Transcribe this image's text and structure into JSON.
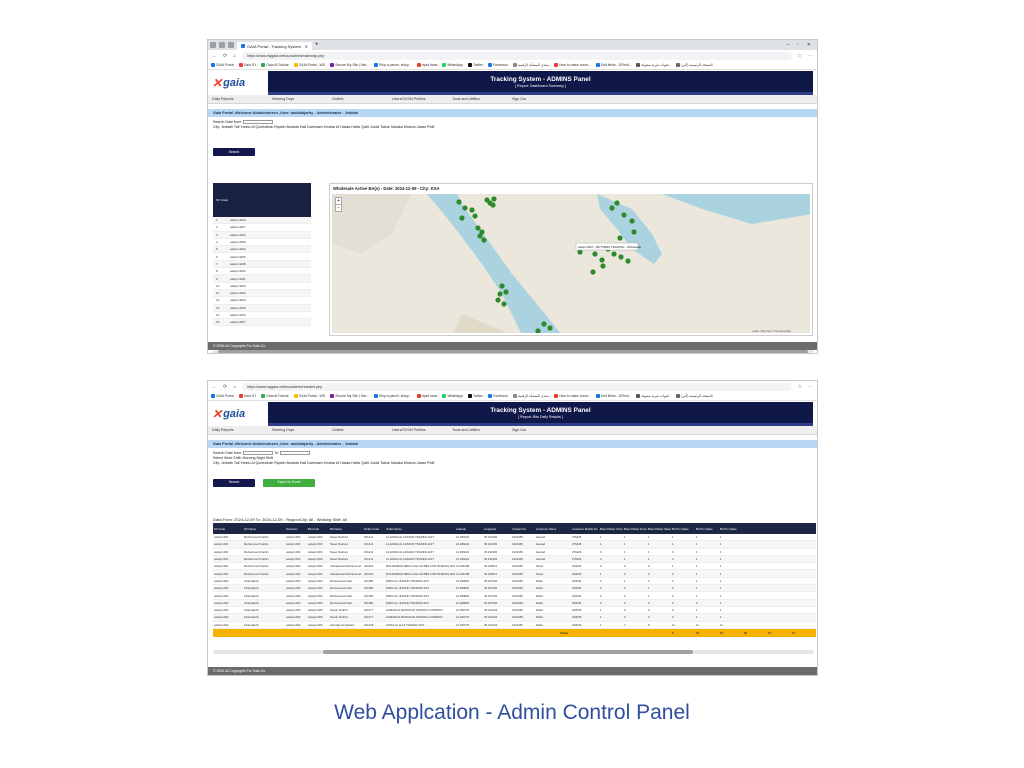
{
  "browser": {
    "tab_title": "GAIA Portal - Tracking System",
    "url_top": "https://www.mygaia.net/sso/admin/mainmap.php",
    "url_bottom": "https://www.mygaia.net/sso/admin/resultmi.php",
    "bookmarks": [
      "GAIA Portal",
      "Gaia SY",
      "Gaia Al Fakhar",
      "GAIA Portal - WD",
      "Secure My Site | Net...",
      "Ship a parcel, shipp...",
      "riyad bank",
      "WhatsApp",
      "Twitter",
      "Facebook",
      "منتدى المنشأة الرقمية",
      "How to make count...",
      "Edit fields - DFIeld...",
      "قنوات غيرية منقولة...",
      "الصفحة الرئيسية (أثير)"
    ]
  },
  "app": {
    "logo_text": "gaia",
    "title": "Tracking System - ADMINS Panel",
    "subtitle_top": "[ Report: Dashboard Summary ]",
    "subtitle_bottom": "[ Report: Bits Daily Results ]",
    "menu": [
      "Daily Reports",
      "Working Days",
      "Outlets",
      "Users/SVSM Profiles",
      "Tools and Utilities",
      "Sign Out"
    ],
    "welcome": "Gaia Portal ,Welcome Abdulmohsen ,User: abdulaljarhy - Administrator - Jeddah"
  },
  "top_screen": {
    "search_label": "Search Date from:",
    "city_line": "City: Jeddah Taif Yanbu Al Qunfudhah Riyadh Buraida Hail Dammam Khobar Al Hassa Hafar Qatif Jubail Tabuk Sakaka Khamis Jazan Rhill",
    "search_button": "Search",
    "table_header": "SV Code",
    "table_rows": [
      {
        "n": "1",
        "code": "salsprm003"
      },
      {
        "n": "2",
        "code": "salsprm007"
      },
      {
        "n": "3",
        "code": "salsprm002"
      },
      {
        "n": "4",
        "code": "salsprm006"
      },
      {
        "n": "5",
        "code": "salsprm002"
      },
      {
        "n": "6",
        "code": "salsprm009"
      },
      {
        "n": "7",
        "code": "salsprm008"
      },
      {
        "n": "8",
        "code": "salsprm002"
      },
      {
        "n": "9",
        "code": "salsprm001"
      },
      {
        "n": "10",
        "code": "salsprm003"
      },
      {
        "n": "11",
        "code": "salsprm004"
      },
      {
        "n": "12",
        "code": "salsprm003"
      },
      {
        "n": "13",
        "code": "salsprm006"
      },
      {
        "n": "14",
        "code": "salsprm003"
      },
      {
        "n": "15",
        "code": "salsprm007"
      }
    ],
    "map_title": "Wholesale Active BA(s) - Date: 2024-12-09 - City: KSA",
    "map_popup": "salsprm007 - BUTTERS TRADING - Wholesale",
    "zoom_in": "+",
    "zoom_out": "−",
    "map_attribution": "Leaflet | Map data © OpenStreetMap",
    "footer": "© 2006 All Copyrights For Gaia Co."
  },
  "bottom_screen": {
    "search_label": "Search Date from:",
    "to_label": "To:",
    "shift_line": "Select Work Shift: Morning Night Shift",
    "city_line": "City: Jeddah Taif Yanbu Al Qunfudhah Riyadh Buraida Hail Dammam Khobar Al Hassa Hafar Qatif Jubail Tabuk Sakaka Khamis Jazan Rhill",
    "search_button": "Search",
    "export_button": "Export to Excel",
    "result_title": "Data From: 2024-12-09 To: 2024-12-09 - Region/City: All - Working Shift: All",
    "columns": [
      "SV Code",
      "SV Name",
      "Promoter",
      "BA Code",
      "BA Name",
      "Outlet Code",
      "Outlet Name",
      "Latitude",
      "Longitude",
      "Contact No",
      "Customer Name",
      "Customer Mobile No",
      "Brand Meter Check",
      "Brand Meter Done",
      "Brand Meter Sales",
      "BA Pro Sales",
      "BA Pro Sales",
      "BA Pro Sales"
    ],
    "rows": [
      [
        "salsprm001",
        "Mohammed Ibrahim",
        "salsprm004",
        "salsprm003",
        "Naser Rashed",
        "321211",
        "AL EIDAN AL HUMAIN TRADING EST",
        "21.489222",
        "39.232182",
        "0123456",
        "Hamad",
        "276226",
        "1",
        "1",
        "1",
        "1",
        "1",
        "1"
      ],
      [
        "salsprm001",
        "Mohammed Ibrahim",
        "salsprm004",
        "salsprm003",
        "Naser Rashed",
        "321211",
        "AL EIDAN AL HUMAIN TRADING EST",
        "21.489222",
        "39.232182",
        "0123456",
        "Hamad",
        "276226",
        "1",
        "1",
        "1",
        "1",
        "1",
        "1"
      ],
      [
        "salsprm001",
        "Mohammed Ibrahim",
        "salsprm004",
        "salsprm003",
        "Naser Rashed",
        "321211",
        "AL EIDAN AL HUMAIN TRADING EST",
        "21.489222",
        "39.232182",
        "0123456",
        "Hamad",
        "276226",
        "0",
        "1",
        "1",
        "0",
        "1",
        "1"
      ],
      [
        "salsprm001",
        "Mohammed Ibrahim",
        "salsprm004",
        "salsprm003",
        "Naser Rashed",
        "321211",
        "AL EIDAN AL HUMAIN TRADING EST",
        "21.489222",
        "39.232182",
        "0123456",
        "Hamad",
        "276226",
        "0",
        "1",
        "1",
        "0",
        "1",
        "1"
      ],
      [
        "salsprm001",
        "Mohammed Ibrahim",
        "salsprm002",
        "salsprm003",
        "Abdulsamad Mohammed",
        "321251",
        "MOHAMMAD ABDULLAH ALTIBDI FOR TRADING EST",
        "21.461298",
        "39.230011",
        "0123456",
        "Naser",
        "320032",
        "0",
        "0",
        "0",
        "1",
        "1",
        "1"
      ],
      [
        "salsprm001",
        "Mohammed Ibrahim",
        "salsprm002",
        "salsprm003",
        "Abdulsamad Mohammed",
        "321251",
        "MOHAMMAD ABDULLAH ALTIBDI FOR TRADING EST",
        "21.461298",
        "39.230011",
        "0123456",
        "Naser",
        "320032",
        "1",
        "0",
        "0",
        "0",
        "1",
        "1"
      ],
      [
        "salsprm002",
        "Fisal Aljarhy",
        "salsprm003",
        "salsprm004",
        "Mohammed Islam",
        "321185",
        "RIMIX AL HUMAIN TRADING EST",
        "21.289820",
        "39.187102",
        "0123456",
        "Rafat",
        "320034",
        "0",
        "1",
        "0",
        "0",
        "1",
        "1"
      ],
      [
        "salsprm002",
        "Fisal Aljarhy",
        "salsprm003",
        "salsprm004",
        "Mohammed Islam",
        "321185",
        "RIMIX AL HUMAIN TRADING EST",
        "21.289820",
        "39.187102",
        "0123456",
        "Rafat",
        "320034",
        "0",
        "0",
        "1",
        "0",
        "1",
        "1"
      ],
      [
        "salsprm002",
        "Fisal Aljarhy",
        "salsprm003",
        "salsprm004",
        "Mohammed Islam",
        "321185",
        "RIMIX AL HUMAIN TRADING EST",
        "21.289820",
        "39.187102",
        "0123456",
        "Rafat",
        "320034",
        "0",
        "0",
        "1",
        "0",
        "1",
        "1"
      ],
      [
        "salsprm002",
        "Fisal Aljarhy",
        "salsprm003",
        "salsprm005",
        "Mohammed Islam",
        "321186",
        "RIMIX AL HUMAIN TRADING EST",
        "21.289820",
        "39.187102",
        "0123456",
        "Rafat",
        "320034",
        "0",
        "0",
        "0",
        "0",
        "0",
        "1"
      ],
      [
        "salsprm002",
        "Fisal Aljarhy",
        "salsprm003",
        "salsprm005",
        "Nasrin Ibrahim",
        "321177",
        "HAMADAN MANSOUR TRADING COMPANY",
        "21.359779",
        "39.222163",
        "0123456",
        "Rafat",
        "320035",
        "1",
        "0",
        "0",
        "0",
        "1",
        "1"
      ],
      [
        "salsprm002",
        "Fisal Aljarhy",
        "salsprm003",
        "salsprm005",
        "Nasrin Ibrahim",
        "321177",
        "HAMADAN MANSOUR TRADING COMPANY",
        "21.359779",
        "39.222163",
        "0123456",
        "Rafat",
        "320035",
        "1",
        "0",
        "0",
        "0",
        "1",
        "1"
      ],
      [
        "salsprm002",
        "Fisal Aljarhy",
        "salsprm003",
        "salsprm006",
        "Hamdan Al Qahtani",
        "321178",
        "IHSAS AL HAJI TRADING EST",
        "21.359779",
        "39.222163",
        "0123456",
        "Rafat",
        "320036",
        "1",
        "7",
        "5",
        "11",
        "11",
        "11"
      ]
    ],
    "total_label": "Totals",
    "totals": [
      "5",
      "19",
      "15",
      "26",
      "51",
      "17"
    ],
    "footer": "© 2006 All Copyrights For Gaia Co."
  },
  "caption": "Web Applcation  - Admin Control Panel"
}
